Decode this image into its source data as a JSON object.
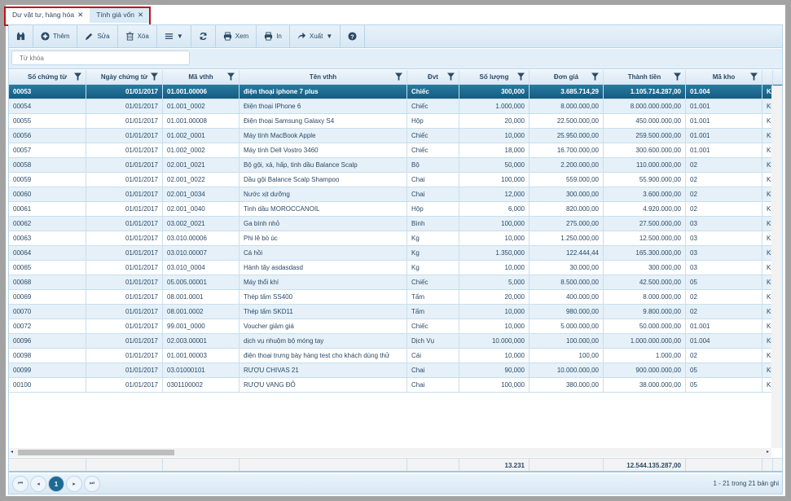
{
  "tabs": [
    {
      "label": "Dư vật tư, hàng hóa",
      "active": true
    },
    {
      "label": "Tính giá vốn",
      "active": false
    }
  ],
  "toolbar": {
    "find_icon": "binoculars-icon",
    "add": "Thêm",
    "edit": "Sửa",
    "delete": "Xóa",
    "menu_icon": "list-menu-icon",
    "refresh_icon": "refresh-icon",
    "view": "Xem",
    "print": "In",
    "export": "Xuất",
    "help_icon": "question-icon"
  },
  "search": {
    "placeholder": "Từ khóa",
    "value": ""
  },
  "columns": [
    "Số chứng từ",
    "Ngày chứng từ",
    "Mã vthh",
    "Tên vthh",
    "Đvt",
    "Số lượng",
    "Đơn giá",
    "Thành tiền",
    "Mã kho",
    ""
  ],
  "rows": [
    [
      "00053",
      "01/01/2017",
      "01.001.00006",
      "điện thoại iphone 7 plus",
      "Chiếc",
      "300,000",
      "3.685.714,29",
      "1.105.714.287,00",
      "01.004",
      "Kh"
    ],
    [
      "00054",
      "01/01/2017",
      "01.001_0002",
      "Điện thoại IPhone 6",
      "Chiếc",
      "1.000,000",
      "8.000.000,00",
      "8.000.000.000,00",
      "01.001",
      "Kh"
    ],
    [
      "00055",
      "01/01/2017",
      "01.001.00008",
      "Điện thoại Samsung Galaxy S4",
      "Hộp",
      "20,000",
      "22.500.000,00",
      "450.000.000,00",
      "01.001",
      "Kh"
    ],
    [
      "00056",
      "01/01/2017",
      "01.002_0001",
      "Máy tính MacBook Apple",
      "Chiếc",
      "10,000",
      "25.950.000,00",
      "259.500.000,00",
      "01.001",
      "Kh"
    ],
    [
      "00057",
      "01/01/2017",
      "01.002_0002",
      "Máy tính Dell Vostro 3460",
      "Chiếc",
      "18,000",
      "16.700.000,00",
      "300.600.000,00",
      "01.001",
      "Kh"
    ],
    [
      "00058",
      "01/01/2017",
      "02.001_0021",
      "Bộ gội, xả, hấp, tinh dầu Balance Scalp",
      "Bộ",
      "50,000",
      "2.200.000,00",
      "110.000.000,00",
      "02",
      "Kh"
    ],
    [
      "00059",
      "01/01/2017",
      "02.001_0022",
      "Dầu gội Balance Scalp Shampoo",
      "Chai",
      "100,000",
      "559.000,00",
      "55.900.000,00",
      "02",
      "Kh"
    ],
    [
      "00060",
      "01/01/2017",
      "02.001_0034",
      "Nước xịt dưỡng",
      "Chai",
      "12,000",
      "300.000,00",
      "3.600.000,00",
      "02",
      "Kh"
    ],
    [
      "00061",
      "01/01/2017",
      "02.001_0040",
      "Tinh dầu MOROCCANOIL",
      "Hộp",
      "6,000",
      "820.000,00",
      "4.920.000,00",
      "02",
      "Kh"
    ],
    [
      "00062",
      "01/01/2017",
      "03.002_0021",
      "Ga bình nhỏ",
      "Bình",
      "100,000",
      "275.000,00",
      "27.500.000,00",
      "03",
      "Kh"
    ],
    [
      "00063",
      "01/01/2017",
      "03.010.00006",
      "Phi lê bò úc",
      "Kg",
      "10,000",
      "1.250.000,00",
      "12.500.000,00",
      "03",
      "Kh"
    ],
    [
      "00064",
      "01/01/2017",
      "03.010.00007",
      "Cá hồi",
      "Kg",
      "1.350,000",
      "122.444,44",
      "165.300.000,00",
      "03",
      "Kh"
    ],
    [
      "00065",
      "01/01/2017",
      "03.010_0004",
      "Hành tây asdasdasd",
      "Kg",
      "10,000",
      "30.000,00",
      "300.000,00",
      "03",
      "Kh"
    ],
    [
      "00068",
      "01/01/2017",
      "05.005.00001",
      "Máy thổi khí",
      "Chiếc",
      "5,000",
      "8.500.000,00",
      "42.500.000,00",
      "05",
      "Kh"
    ],
    [
      "00069",
      "01/01/2017",
      "08.001.0001",
      "Thép tấm SS400",
      "Tấm",
      "20,000",
      "400.000,00",
      "8.000.000,00",
      "02",
      "Kh"
    ],
    [
      "00070",
      "01/01/2017",
      "08.001.0002",
      "Thép tấm SKD11",
      "Tấm",
      "10,000",
      "980.000,00",
      "9.800.000,00",
      "02",
      "Kh"
    ],
    [
      "00072",
      "01/01/2017",
      "99.001_0000",
      "Voucher giảm giá",
      "Chiếc",
      "10,000",
      "5.000.000,00",
      "50.000.000,00",
      "01.001",
      "Kh"
    ],
    [
      "00096",
      "01/01/2017",
      "02.003.00001",
      "dịch vụ nhuộm bộ móng tay",
      "Dịch Vụ",
      "10.000,000",
      "100.000,00",
      "1.000.000.000,00",
      "01.004",
      "Kh"
    ],
    [
      "00098",
      "01/01/2017",
      "01.001.00003",
      "điện thoại trưng bày hàng test cho khách dùng thử",
      "Cái",
      "10,000",
      "100,00",
      "1.000,00",
      "02",
      "Kh"
    ],
    [
      "00099",
      "01/01/2017",
      "03.01000101",
      "RƯỢU CHIVAS 21",
      "Chai",
      "90,000",
      "10.000.000,00",
      "900.000.000,00",
      "05",
      "Kh"
    ],
    [
      "00100",
      "01/01/2017",
      "0301100002",
      "RƯỢU VANG ĐỎ",
      "Chai",
      "100,000",
      "380.000,00",
      "38.000.000,00",
      "05",
      "Kh"
    ]
  ],
  "selected_row": 0,
  "totals": {
    "quantity": "13.231",
    "amount": "12.544.135.287,00"
  },
  "pager": {
    "first": "first-page-icon",
    "prev": "prev-page-icon",
    "current": "1",
    "next": "next-page-icon",
    "last": "last-page-icon",
    "info": "1 - 21 trong 21 bản ghi"
  },
  "colors": {
    "selected": "#1d6a92",
    "alt_row": "#e5f0f8",
    "highlight_border": "#c0121b"
  }
}
